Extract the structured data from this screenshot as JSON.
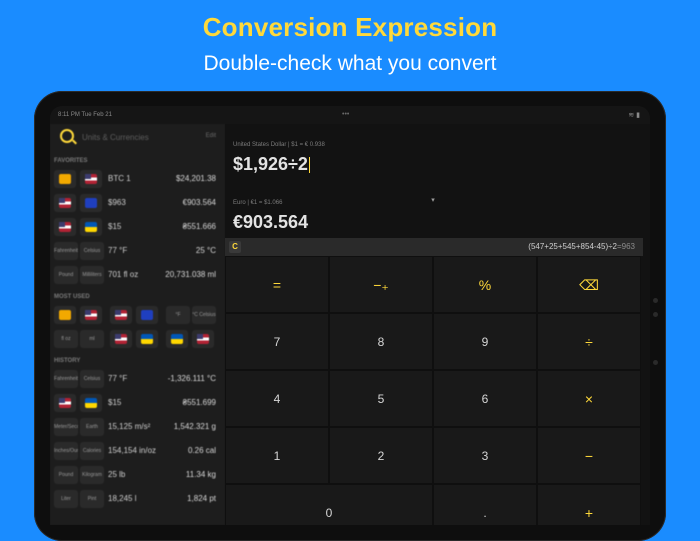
{
  "promo": {
    "headline": "Conversion Expression",
    "subline": "Double-check what you convert"
  },
  "status": {
    "time": "8:11 PM  Tue Feb 21",
    "dots": "•••",
    "battery": "≋ ▮"
  },
  "search": {
    "placeholder": "Units & Currencies",
    "edit_label": "Edit"
  },
  "sections": {
    "favorites": "FAVORITES",
    "most_used": "MOST USED",
    "history": "HISTORY"
  },
  "favorites": [
    {
      "from": "BTC 1",
      "to": "$24,201.38"
    },
    {
      "from": "$963",
      "to": "€903.564"
    },
    {
      "from": "$15",
      "to": "₴551.666"
    },
    {
      "l1": "Fahrenheit",
      "l2": "Celsius",
      "from": "77 °F",
      "to": "25 °C"
    },
    {
      "l1": "Pound Rocket (US)",
      "l2": "Milliliters",
      "from": "701 fl oz",
      "to": "20,731.038 ml"
    }
  ],
  "most_used": {
    "row1": [
      "°F Fahrenheit",
      "°C Celsius"
    ],
    "row2": [
      "fl oz",
      "ml Milliliters"
    ]
  },
  "history": [
    {
      "l1": "Fahrenheit",
      "l2": "Celsius",
      "from": "77 °F",
      "to": "-1,326.111 °C"
    },
    {
      "from": "$15",
      "to": "₴551.699"
    },
    {
      "l1": "Meter/Second²",
      "l2": "Earth Gravity",
      "from": "15,125 m/s²",
      "to": "1,542.321 g"
    },
    {
      "l1": "Inches/Ounce",
      "l2": "Calories",
      "from": "154,154 in/oz",
      "to": "0.26 cal"
    },
    {
      "l1": "Pound (US)",
      "l2": "Kilogram",
      "from": "25 lb",
      "to": "11.34 kg"
    },
    {
      "l1": "Liter",
      "l2": "Pint",
      "from": "18,245 l",
      "to": "1,824 pt"
    }
  ],
  "converter": {
    "source_label": "United States Dollar | $1 = € 0.938",
    "source_value": "$1,926÷2",
    "dest_label": "Euro | €1 = $1.066",
    "dest_value": "€903.564",
    "expression_clear": "C",
    "expression": "(547+25+545+854-45)÷2",
    "expression_result": "=963"
  },
  "keys": {
    "row1": [
      "=",
      "−₊",
      "%",
      "⌫"
    ],
    "row2": [
      "7",
      "8",
      "9",
      "÷"
    ],
    "row3": [
      "4",
      "5",
      "6",
      "×"
    ],
    "row4": [
      "1",
      "2",
      "3",
      "−"
    ],
    "row5": [
      "0",
      ".",
      "+"
    ]
  },
  "colors": {
    "background": "#1a8cff",
    "accent": "#ffd93a"
  }
}
